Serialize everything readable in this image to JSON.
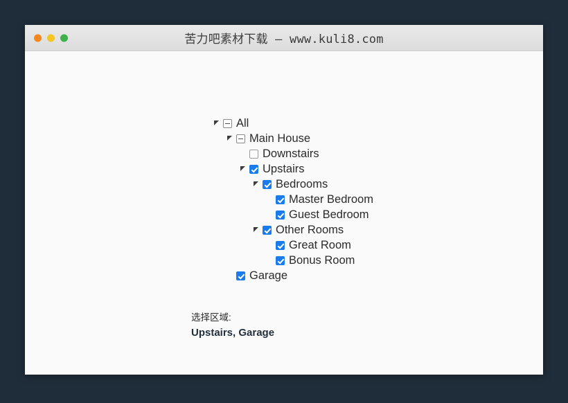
{
  "window": {
    "title": "苦力吧素材下载 – www.kuli8.com",
    "controls": {
      "close_label": "",
      "minimize_label": "",
      "maximize_label": ""
    },
    "colors": {
      "desktop_background": "#1f2d3a",
      "titlebar": "#e2e2e2",
      "content_background": "#fafafa",
      "accent": "#1a7bed",
      "close_dot": "#f5871f",
      "minimize_dot": "#f3c623",
      "maximize_dot": "#3cb34a"
    }
  },
  "tree": {
    "nodes": [
      {
        "label": "All",
        "depth": 0,
        "state": "indeterminate",
        "expandable": true,
        "expanded": true
      },
      {
        "label": "Main House",
        "depth": 1,
        "state": "indeterminate",
        "expandable": true,
        "expanded": true
      },
      {
        "label": "Downstairs",
        "depth": 2,
        "state": "unchecked",
        "expandable": false,
        "expanded": false
      },
      {
        "label": "Upstairs",
        "depth": 2,
        "state": "checked",
        "expandable": true,
        "expanded": true
      },
      {
        "label": "Bedrooms",
        "depth": 3,
        "state": "checked",
        "expandable": true,
        "expanded": true
      },
      {
        "label": "Master Bedroom",
        "depth": 4,
        "state": "checked",
        "expandable": false,
        "expanded": false
      },
      {
        "label": "Guest Bedroom",
        "depth": 4,
        "state": "checked",
        "expandable": false,
        "expanded": false
      },
      {
        "label": "Other Rooms",
        "depth": 3,
        "state": "checked",
        "expandable": true,
        "expanded": true
      },
      {
        "label": "Great Room",
        "depth": 4,
        "state": "checked",
        "expandable": false,
        "expanded": false
      },
      {
        "label": "Bonus Room",
        "depth": 4,
        "state": "checked",
        "expandable": false,
        "expanded": false
      },
      {
        "label": "Garage",
        "depth": 1,
        "state": "checked",
        "expandable": false,
        "expanded": false
      }
    ]
  },
  "footer": {
    "label": "选择区域:",
    "value": "Upstairs, Garage"
  }
}
